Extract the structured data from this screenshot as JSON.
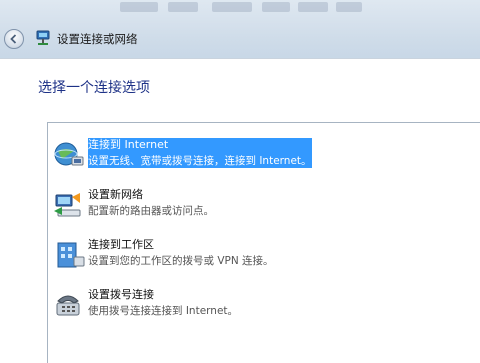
{
  "window": {
    "title": "设置连接或网络"
  },
  "header": {
    "title": "选择一个连接选项"
  },
  "options": [
    {
      "title": "连接到 Internet",
      "description": "设置无线、宽带或拨号连接，连接到 Internet。",
      "selected": true,
      "icon": "globe-network-icon"
    },
    {
      "title": "设置新网络",
      "description": "配置新的路由器或访问点。",
      "selected": false,
      "icon": "router-setup-icon"
    },
    {
      "title": "连接到工作区",
      "description": "设置到您的工作区的拨号或 VPN 连接。",
      "selected": false,
      "icon": "workplace-icon"
    },
    {
      "title": "设置拨号连接",
      "description": "使用拨号连接连接到 Internet。",
      "selected": false,
      "icon": "dialup-phone-icon"
    }
  ],
  "colors": {
    "selection": "#3399ff",
    "header_text": "#1e3287"
  }
}
